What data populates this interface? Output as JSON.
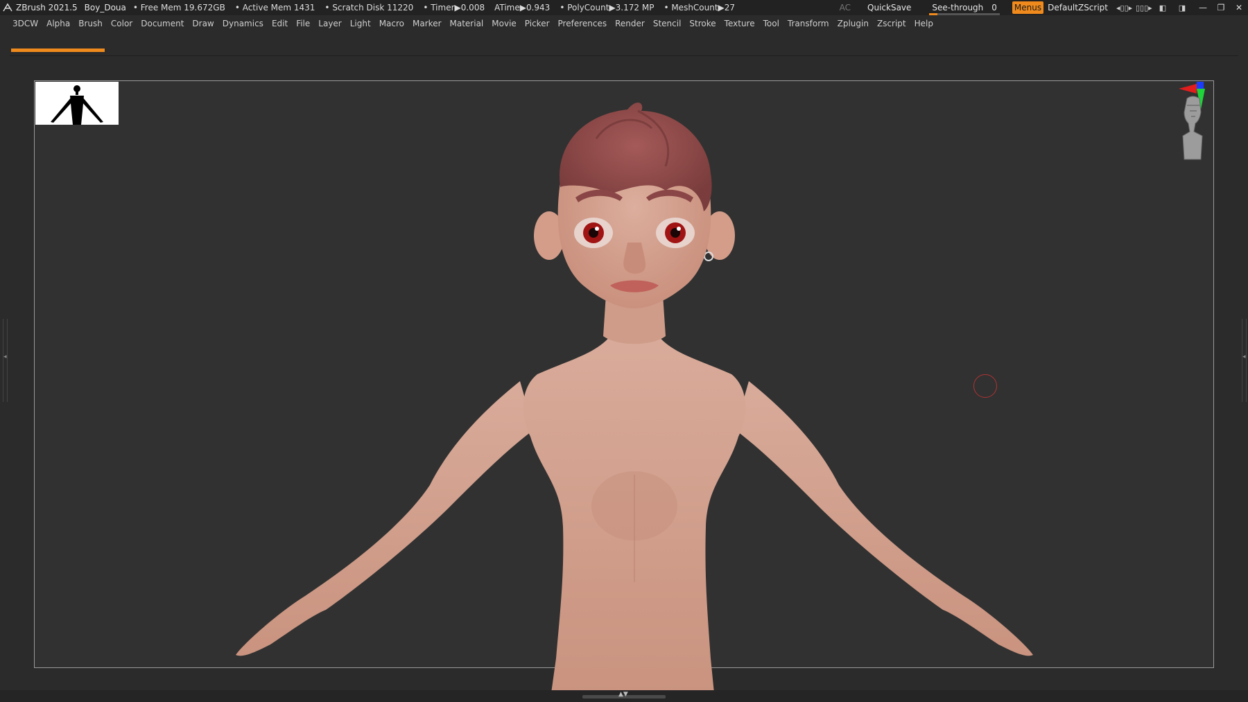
{
  "titlebar": {
    "app_version": "ZBrush 2021.5",
    "project": "Boy_Doua",
    "free_mem": "• Free Mem 19.672GB",
    "active_mem": "• Active Mem 1431",
    "scratch_disk": "• Scratch Disk 11220",
    "timer": "• Timer▶0.008",
    "atime": "ATime▶0.943",
    "polycount": "• PolyCount▶3.172 MP",
    "meshcount": "• MeshCount▶27",
    "ac": "AC",
    "quicksave": "QuickSave",
    "see_through_label": "See-through",
    "see_through_value": "0",
    "menus": "Menus",
    "script": "DefaultZScript"
  },
  "menubar": {
    "items": [
      "3DCW",
      "Alpha",
      "Brush",
      "Color",
      "Document",
      "Draw",
      "Dynamics",
      "Edit",
      "File",
      "Layer",
      "Light",
      "Macro",
      "Marker",
      "Material",
      "Movie",
      "Picker",
      "Preferences",
      "Render",
      "Stencil",
      "Stroke",
      "Texture",
      "Tool",
      "Transform",
      "Zplugin",
      "Zscript",
      "Help"
    ]
  },
  "colors": {
    "accent": "#f08a1c",
    "skin": "#d4a493",
    "hair": "#8e4a4a",
    "iris": "#a11414"
  },
  "icons": {
    "app_logo": "zbrush-logo-icon",
    "gizmo": "head-gizmo-icon"
  }
}
